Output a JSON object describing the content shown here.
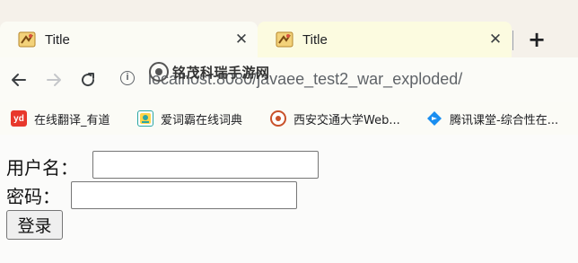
{
  "tabs": [
    {
      "title": "Title",
      "close_label": "✕"
    },
    {
      "title": "Title",
      "close_label": "✕"
    }
  ],
  "new_tab_label": "+",
  "address_bar": {
    "url": "localhost:8080/javaee_test2_war_exploded/",
    "info_label": "i"
  },
  "watermark": {
    "text": "铭茂科瑞手游网"
  },
  "bookmarks": [
    {
      "label": "在线翻译_有道",
      "icon": "youdao-icon",
      "icon_text": "yd",
      "color": "#e8382c"
    },
    {
      "label": "爱词霸在线词典",
      "icon": "iciba-icon",
      "icon_text": "",
      "color": "#2aa6a4"
    },
    {
      "label": "西安交通大学Web...",
      "icon": "xjtu-seal-icon",
      "icon_text": "",
      "color": "#c9512a"
    },
    {
      "label": "腾讯课堂-综合性在...",
      "icon": "tencent-classroom-icon",
      "icon_text": "",
      "color": "#1a8ef0"
    }
  ],
  "form": {
    "username_label": "用户名：",
    "username_value": "",
    "password_label": "密码：",
    "password_value": "",
    "submit_label": "登录"
  }
}
